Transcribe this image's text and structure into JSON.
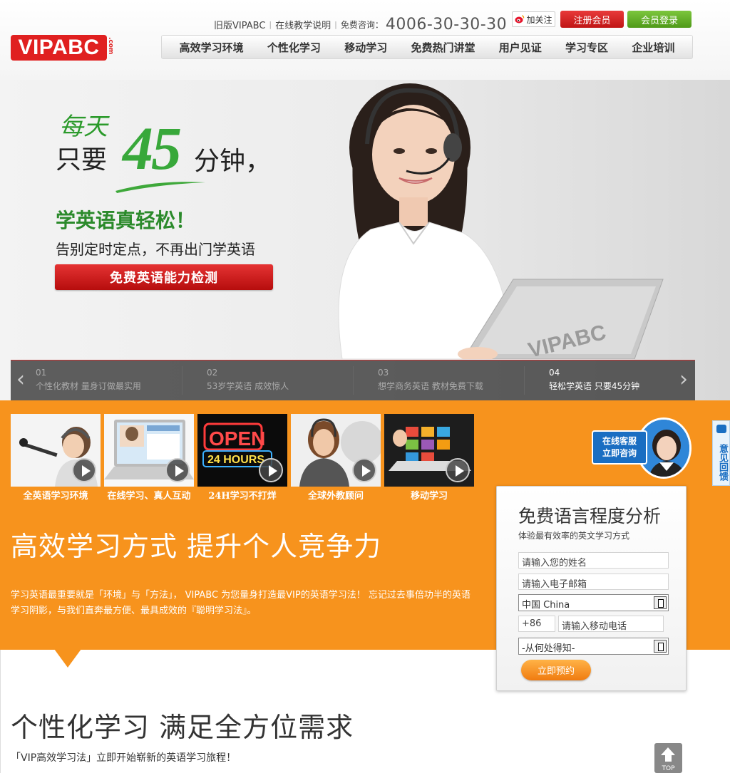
{
  "header": {
    "logo": "VIPABC",
    "logo_suffix": ".com",
    "links": [
      "旧版VIPABC",
      "在线教学说明"
    ],
    "hotline_label": "免费咨询：",
    "hotline": "4006-30-30-30",
    "weibo": "加关注",
    "register": "注册会员",
    "login": "会员登录"
  },
  "nav": [
    "高效学习环境",
    "个性化学习",
    "移动学习",
    "免费热门讲堂",
    "用户见证",
    "学习专区",
    "企业培训"
  ],
  "hero": {
    "daily": "每天",
    "only": "只要",
    "number": "45",
    "minutes": "分钟，",
    "slogan": "学英语真轻松！",
    "subslogan": "告别定时定点，不再出门学英语",
    "cta": "免费英语能力检测",
    "laptop_brand": "VIPABC"
  },
  "strip": [
    {
      "num": "01",
      "text": "个性化教材 量身订做最实用"
    },
    {
      "num": "02",
      "text": "53岁学英语 成效惊人"
    },
    {
      "num": "03",
      "text": "想学商务英语 教材免费下载"
    },
    {
      "num": "04",
      "text": "轻松学英语 只要45分钟"
    }
  ],
  "features": [
    {
      "caption": "全英语学习环境"
    },
    {
      "caption": "在线学习、真人互动"
    },
    {
      "caption": "24H学习不打烊",
      "sign_top": "OPEN",
      "sign_bottom": "24 HOURS"
    },
    {
      "caption": "全球外教顾问"
    },
    {
      "caption": "移动学习"
    }
  ],
  "main": {
    "headline": "高效学习方式  提升个人竞争力",
    "intro": "学习英语最重要就是「环境」与「方法」， VIPABC 为您量身打造最VIP的英语学习法！ 忘记过去事倍功半的英语学习阴影，与我们直奔最方便、最具成效的『聪明学习法』。"
  },
  "service": {
    "line1": "在线客服",
    "line2": "立即咨询"
  },
  "feedback": "意见回馈",
  "form": {
    "title": "免费语言程度分析",
    "subtitle": "体验最有效率的英文学习方式",
    "name_placeholder": "请输入您的姓名",
    "email_placeholder": "请输入电子邮箱",
    "country": "中国 China",
    "country_code": "+86",
    "phone_placeholder": "请输入移动电话",
    "source": "-从何处得知-",
    "submit": "立即预约"
  },
  "section2": {
    "title": "个性化学习  满足全方位需求",
    "subtitle": "「VIP高效学习法」立即开始崭新的英语学习旅程！"
  },
  "top_button": "TOP",
  "colors": {
    "brand_red": "#e02020",
    "orange": "#f7931d",
    "green": "#38a83a",
    "service_blue": "#1a6ec2"
  }
}
